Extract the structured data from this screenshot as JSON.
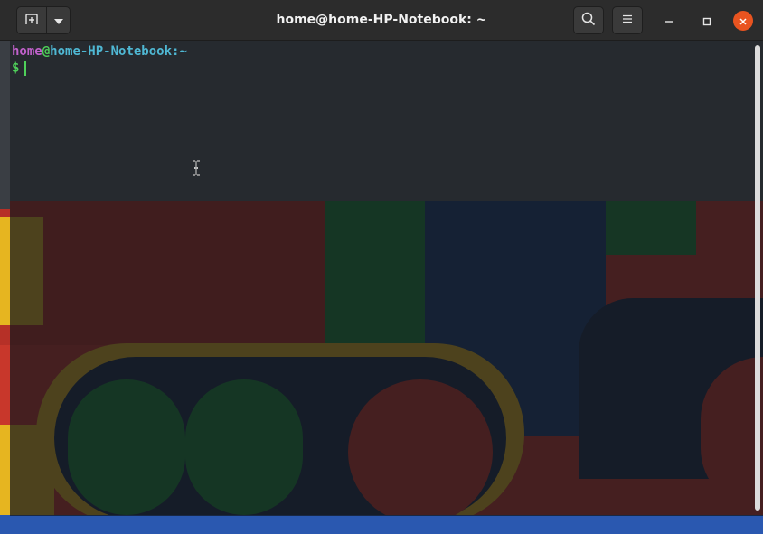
{
  "window": {
    "title": "home@home-HP-Notebook: ~"
  },
  "terminal": {
    "prompt_user": "home",
    "prompt_at": "@",
    "prompt_host": "home-HP-Notebook",
    "prompt_path": ":~",
    "prompt_symbol": "$"
  },
  "colors": {
    "user": "#c061cb",
    "host": "#4fb8d4",
    "symbol": "#4fd05a",
    "close_button": "#e95420",
    "titlebar": "#2c2c2c",
    "terminal_bg": "#262a2f"
  },
  "icons": {
    "new_tab": "new-tab-icon",
    "tab_menu": "chevron-down-icon",
    "search": "search-icon",
    "menu": "hamburger-menu-icon",
    "minimize": "minimize-icon",
    "maximize": "maximize-icon",
    "close": "close-icon"
  }
}
